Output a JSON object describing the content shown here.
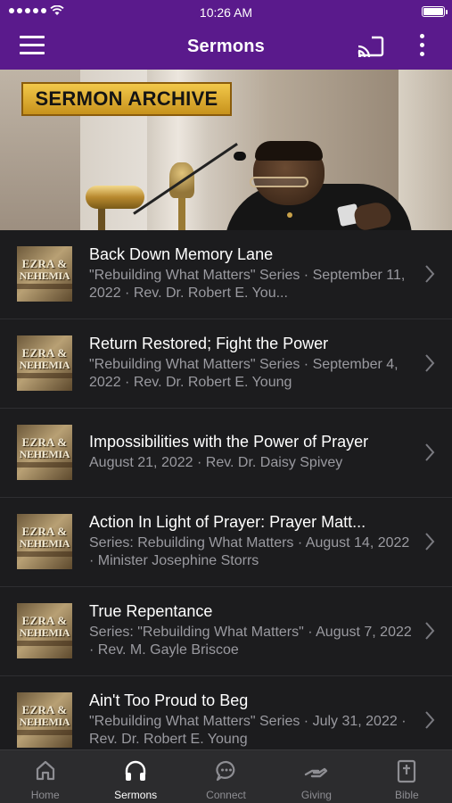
{
  "status_bar": {
    "time": "10:26 AM",
    "signal_dots": 5,
    "wifi_icon": "wifi-icon",
    "battery_level": 1.0
  },
  "nav": {
    "title": "Sermons",
    "menu_icon": "hamburger-menu-icon",
    "cast_icon": "cast-icon",
    "more_icon": "more-vertical-icon"
  },
  "hero": {
    "banner_text": "SERMON ARCHIVE"
  },
  "thumbnail": {
    "line1": "EZRA &",
    "line2": "NEHEMIA"
  },
  "sermons": [
    {
      "title": "Back Down Memory Lane",
      "subtitle": "\"Rebuilding What Matters\" Series · September 11, 2022 · Rev. Dr. Robert E. You..."
    },
    {
      "title": "Return Restored; Fight the Power",
      "subtitle": "\"Rebuilding What Matters\" Series · September 4, 2022 · Rev. Dr. Robert E. Young"
    },
    {
      "title": "Impossibilities with the Power of Prayer",
      "subtitle": "August 21, 2022 · Rev. Dr. Daisy Spivey"
    },
    {
      "title": "Action In Light of Prayer: Prayer Matt...",
      "subtitle": "Series: Rebuilding What Matters · August 14, 2022 · Minister Josephine Storrs"
    },
    {
      "title": "True Repentance",
      "subtitle": "Series: \"Rebuilding What Matters\" · August 7, 2022 · Rev. M. Gayle Briscoe"
    },
    {
      "title": "Ain't Too Proud to Beg",
      "subtitle": "\"Rebuilding What Matters\" Series · July 31, 2022 · Rev. Dr. Robert E. Young"
    }
  ],
  "tabs": [
    {
      "label": "Home",
      "icon": "home-icon",
      "active": false
    },
    {
      "label": "Sermons",
      "icon": "headphones-icon",
      "active": true
    },
    {
      "label": "Connect",
      "icon": "chat-bubble-icon",
      "active": false
    },
    {
      "label": "Giving",
      "icon": "giving-hand-icon",
      "active": false
    },
    {
      "label": "Bible",
      "icon": "bible-icon",
      "active": false
    }
  ],
  "colors": {
    "brand_purple": "#5a1a8c",
    "background": "#1c1c1e",
    "tabbar": "#2c2c2e",
    "subtitle_gray": "#9a9aa0"
  }
}
